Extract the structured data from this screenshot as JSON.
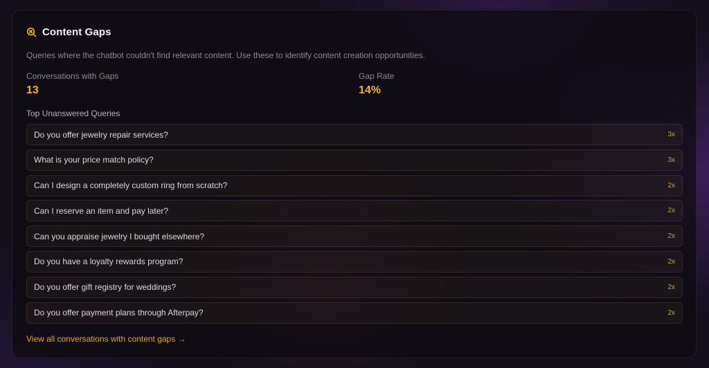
{
  "panel": {
    "title": "Content Gaps",
    "icon": "search-x-icon",
    "accent_color": "#f2b42a",
    "description": "Queries where the chatbot couldn't find relevant content. Use these to identify content creation opportunities."
  },
  "stats": {
    "conversations_with_gaps": {
      "label": "Conversations with Gaps",
      "value": "13"
    },
    "gap_rate": {
      "label": "Gap Rate",
      "value": "14%"
    }
  },
  "queries_section": {
    "label": "Top Unanswered Queries",
    "items": [
      {
        "query": "Do you offer jewelry repair services?",
        "count": "3x"
      },
      {
        "query": "What is your price match policy?",
        "count": "3x"
      },
      {
        "query": "Can I design a completely custom ring from scratch?",
        "count": "2x"
      },
      {
        "query": "Can I reserve an item and pay later?",
        "count": "2x"
      },
      {
        "query": "Can you appraise jewelry I bought elsewhere?",
        "count": "2x"
      },
      {
        "query": "Do you have a loyalty rewards program?",
        "count": "2x"
      },
      {
        "query": "Do you offer gift registry for weddings?",
        "count": "2x"
      },
      {
        "query": "Do you offer payment plans through Afterpay?",
        "count": "2x"
      }
    ]
  },
  "footer": {
    "link_label": "View all conversations with content gaps →"
  }
}
